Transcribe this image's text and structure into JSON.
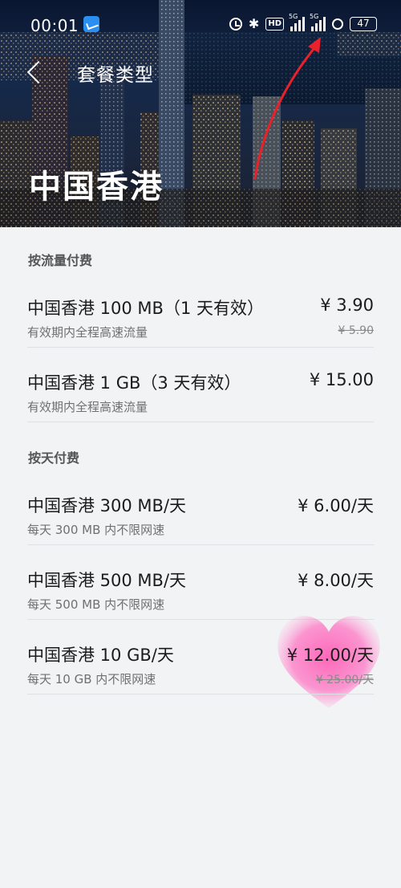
{
  "status_bar": {
    "time": "00:01",
    "icons": [
      "notification-app-icon",
      "alarm-icon",
      "bluetooth-icon",
      "hd-icon",
      "signal-5g-icon",
      "signal-5g-icon"
    ],
    "battery": "47"
  },
  "header": {
    "title": "套餐类型",
    "region": "中国香港"
  },
  "sections": [
    {
      "title": "按流量付费",
      "plans": [
        {
          "name": "中国香港 100 MB（1 天有效）",
          "desc": "有效期内全程高速流量",
          "price": "¥ 3.90",
          "original": "¥ 5.90"
        },
        {
          "name": "中国香港 1 GB（3 天有效）",
          "desc": "有效期内全程高速流量",
          "price": "¥ 15.00",
          "original": ""
        }
      ]
    },
    {
      "title": "按天付费",
      "plans": [
        {
          "name": "中国香港 300 MB/天",
          "desc": "每天 300 MB 内不限网速",
          "price": "¥ 6.00/天",
          "original": ""
        },
        {
          "name": "中国香港 500 MB/天",
          "desc": "每天 500 MB 内不限网速",
          "price": "¥ 8.00/天",
          "original": ""
        },
        {
          "name": "中国香港 10 GB/天",
          "desc": "每天 10 GB 内不限网速",
          "price": "¥ 12.00/天",
          "original": "¥ 25.00/天"
        }
      ]
    }
  ],
  "colors": {
    "page_bg": "#f2f3f5",
    "annotation_arrow": "#e8212b",
    "annotation_heart": "#ff5bb7"
  }
}
